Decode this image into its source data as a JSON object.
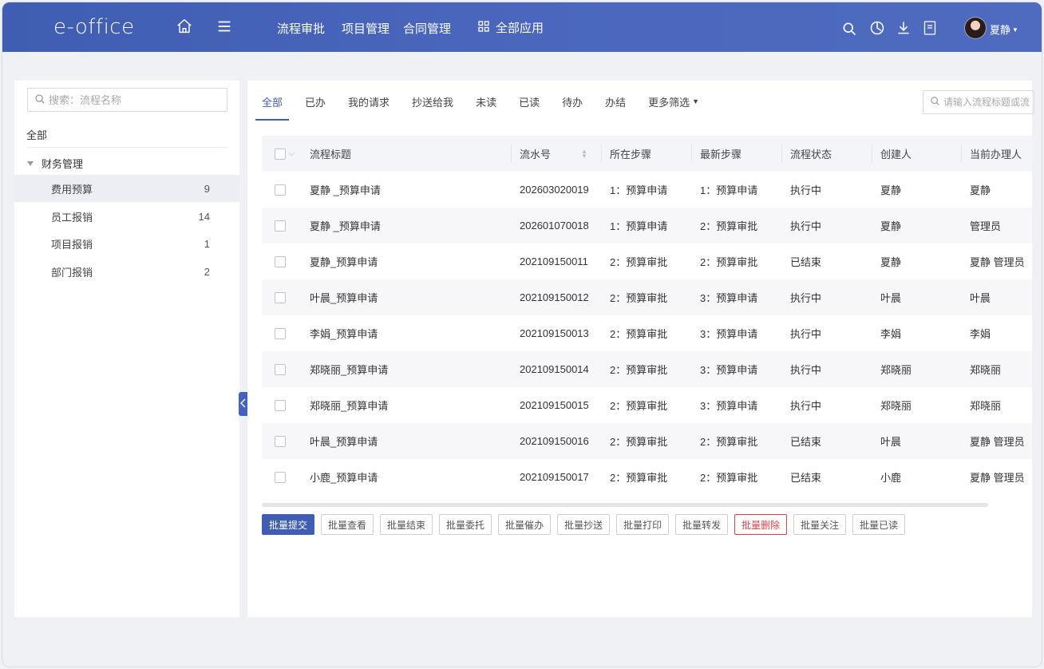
{
  "app": {
    "logo": "e-office"
  },
  "topnav": {
    "links": [
      "流程审批",
      "项目管理",
      "合同管理"
    ],
    "all_apps": "全部应用",
    "user": "夏静"
  },
  "sidebar": {
    "search_placeholder": "搜索：流程名称",
    "all_label": "全部",
    "group_label": "财务管理",
    "items": [
      {
        "label": "费用预算",
        "count": "9"
      },
      {
        "label": "员工报销",
        "count": "14"
      },
      {
        "label": "项目报销",
        "count": "1"
      },
      {
        "label": "部门报销",
        "count": "2"
      }
    ]
  },
  "tabs": [
    "全部",
    "已办",
    "我的请求",
    "抄送给我",
    "未读",
    "已读",
    "待办",
    "办结",
    "更多筛选"
  ],
  "table_search_placeholder": "请输入流程标题或流",
  "table": {
    "headers": [
      "流程标题",
      "流水号",
      "所在步骤",
      "最新步骤",
      "流程状态",
      "创建人",
      "当前办理人"
    ],
    "rows": [
      {
        "title": "夏静 _预算申请",
        "serial": "202603020019",
        "step": "1：预算申请",
        "latest": "1：预算申请",
        "status": "执行中",
        "creator": "夏静",
        "handler": "夏静"
      },
      {
        "title": "夏静 _预算申请",
        "serial": "202601070018",
        "step": "1：预算申请",
        "latest": "2：预算审批",
        "status": "执行中",
        "creator": "夏静",
        "handler": "管理员"
      },
      {
        "title": "夏静_预算申请",
        "serial": "202109150011",
        "step": "2：预算审批",
        "latest": "2：预算审批",
        "status": "已结束",
        "creator": "夏静",
        "handler": "夏静  管理员"
      },
      {
        "title": "叶晨_预算申请",
        "serial": "202109150012",
        "step": "2：预算审批",
        "latest": "3：预算申请",
        "status": "执行中",
        "creator": "叶晨",
        "handler": "叶晨"
      },
      {
        "title": "李娟_预算申请",
        "serial": "202109150013",
        "step": "2：预算审批",
        "latest": "3：预算申请",
        "status": "执行中",
        "creator": "李娟",
        "handler": "李娟"
      },
      {
        "title": "郑晓丽_预算申请",
        "serial": "202109150014",
        "step": "2：预算审批",
        "latest": "3：预算申请",
        "status": "执行中",
        "creator": "郑晓丽",
        "handler": "郑晓丽"
      },
      {
        "title": "郑晓丽_预算申请",
        "serial": "202109150015",
        "step": "2：预算审批",
        "latest": "3：预算申请",
        "status": "执行中",
        "creator": "郑晓丽",
        "handler": "郑晓丽"
      },
      {
        "title": "叶晨_预算申请",
        "serial": "202109150016",
        "step": "2：预算审批",
        "latest": "2：预算审批",
        "status": "已结束",
        "creator": "叶晨",
        "handler": "夏静  管理员"
      },
      {
        "title": "小鹿_预算申请",
        "serial": "202109150017",
        "step": "2：预算审批",
        "latest": "2：预算审批",
        "status": "已结束",
        "creator": "小鹿",
        "handler": "夏静  管理员"
      }
    ]
  },
  "batch_buttons": [
    "批量提交",
    "批量查看",
    "批量结束",
    "批量委托",
    "批量催办",
    "批量抄送",
    "批量打印",
    "批量转发",
    "批量删除",
    "批量关注",
    "批量已读"
  ],
  "colors": {
    "primary": "#3f5db2",
    "danger": "#e0404a"
  }
}
